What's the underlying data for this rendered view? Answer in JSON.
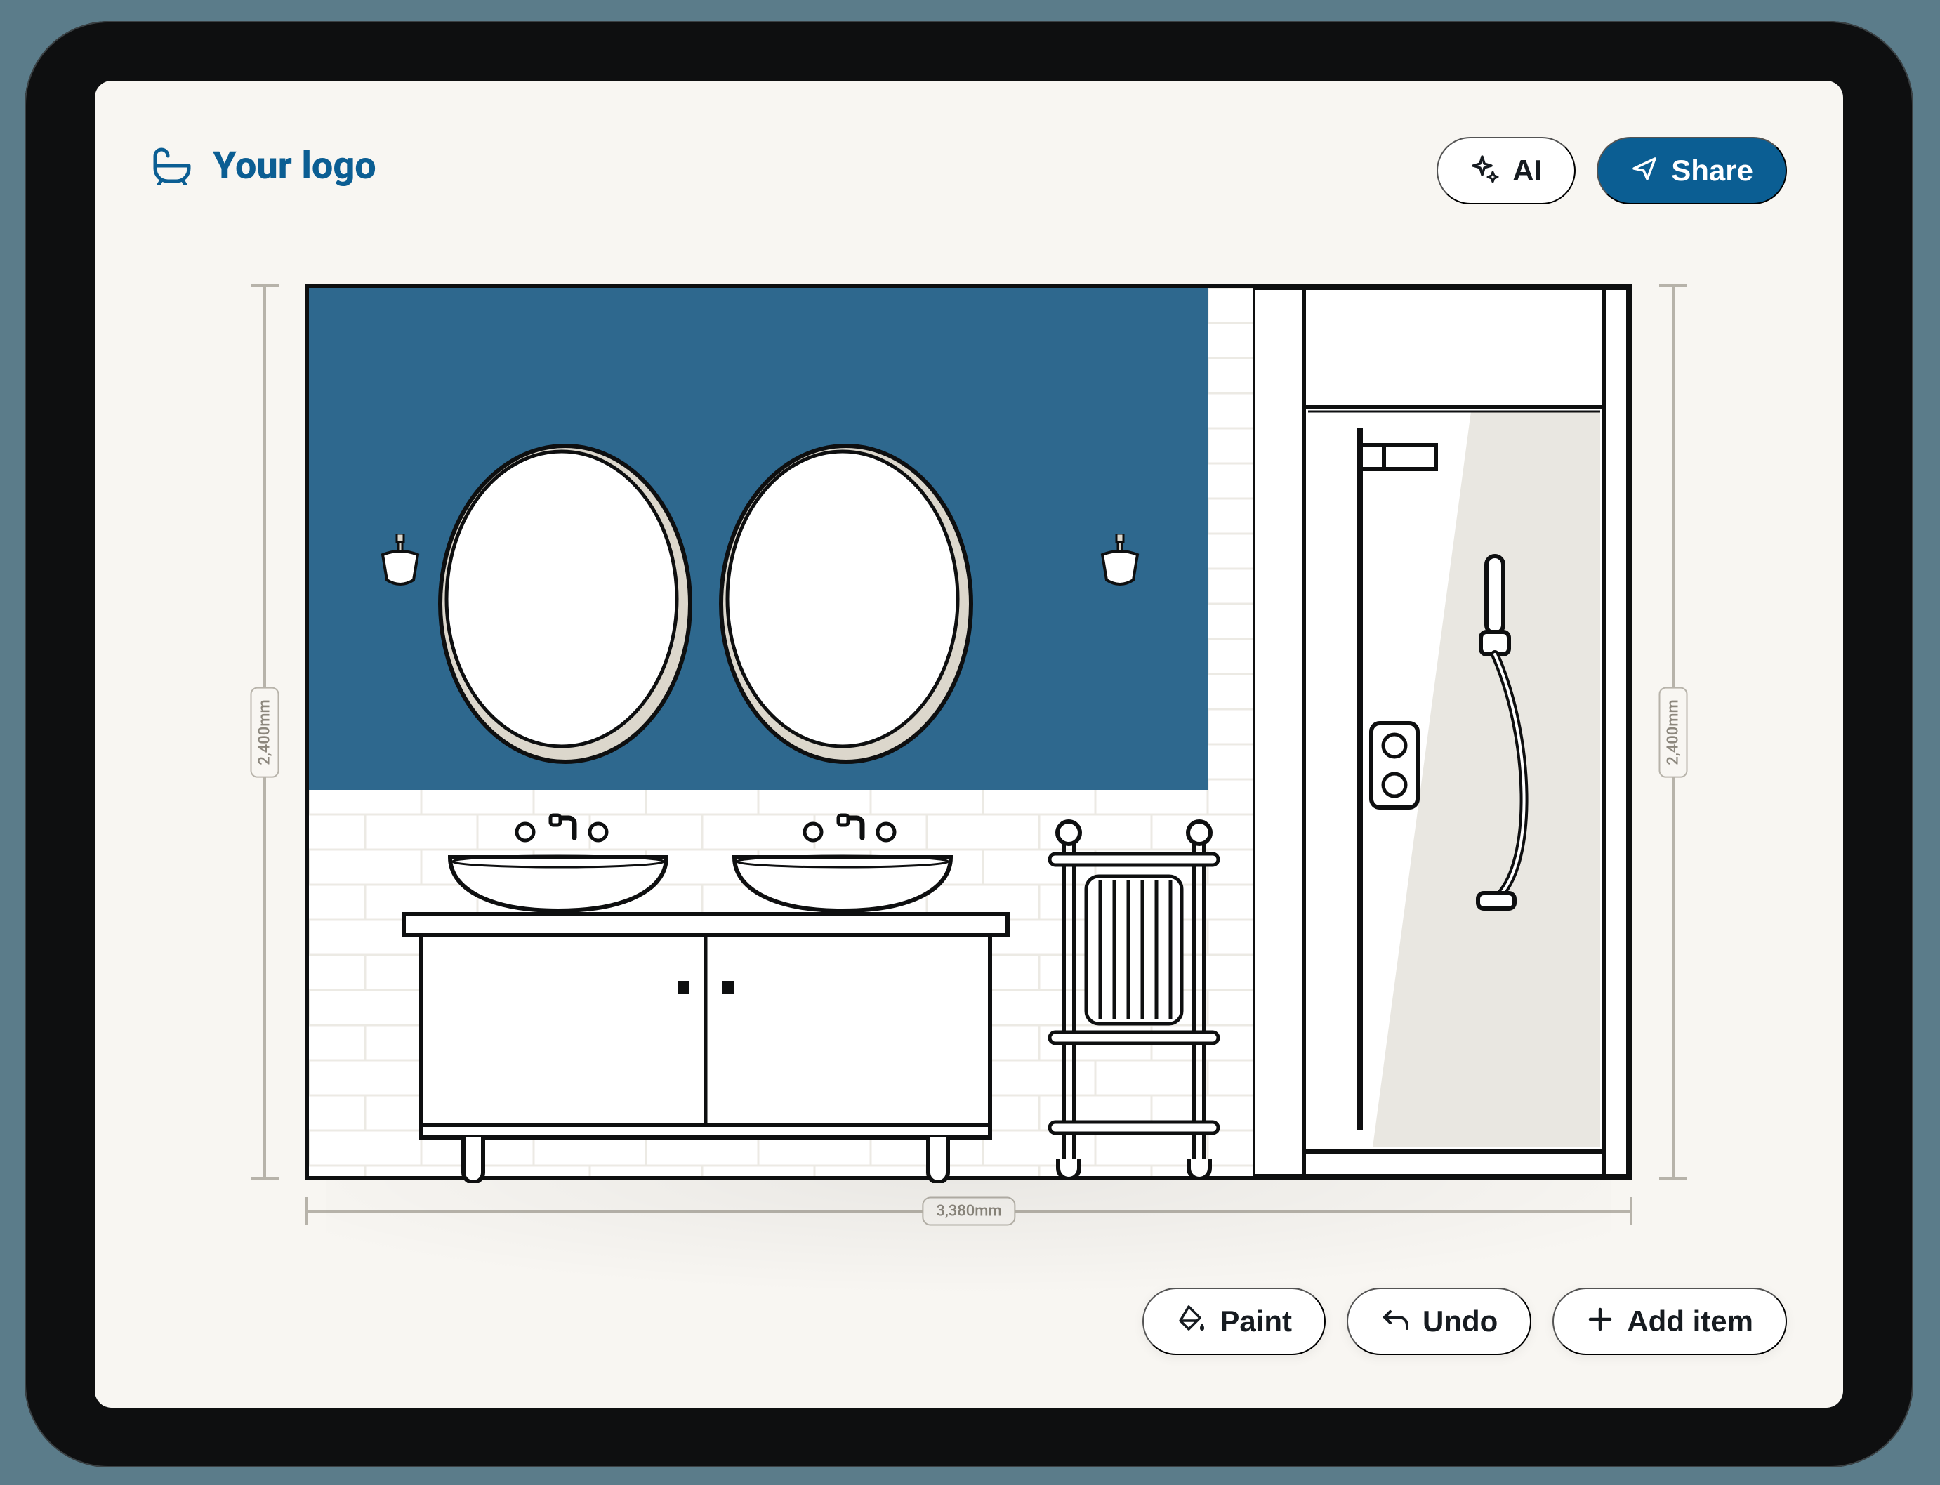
{
  "brand": {
    "logo_text": "Your logo"
  },
  "header": {
    "ai_label": "AI",
    "share_label": "Share"
  },
  "canvas": {
    "height_label": "2,400mm",
    "width_label": "3,380mm",
    "feature_wall_color": "#2e688e"
  },
  "toolbar": {
    "paint_label": "Paint",
    "undo_label": "Undo",
    "add_item_label": "Add item"
  }
}
